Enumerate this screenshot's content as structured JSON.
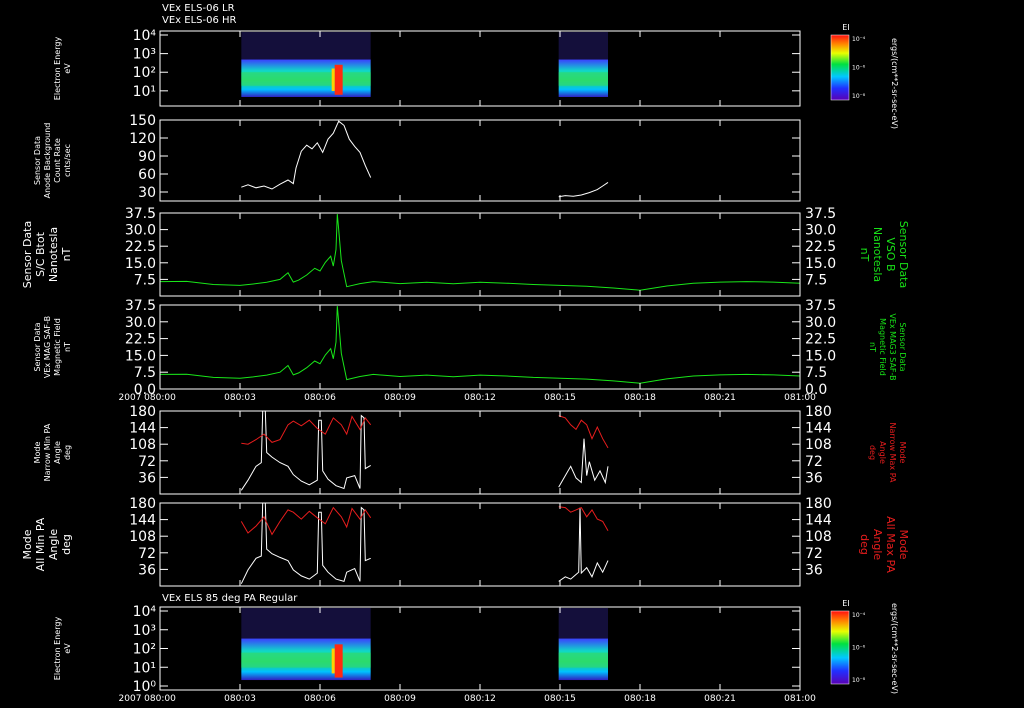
{
  "header": {
    "line1": "VEx ELS-06 LR",
    "line2": "VEx ELS-06 HR",
    "bottom_title": "VEx ELS 85 deg PA Regular"
  },
  "colors": {
    "background": "#000000",
    "white_trace": "#ffffff",
    "green_trace": "#19e619",
    "red_trace": "#e81d1d",
    "green_label": "#18e218",
    "red_label": "#e81d1d"
  },
  "time_axis": {
    "year_label": "2007",
    "ticks": [
      "080:00",
      "080:03",
      "080:06",
      "080:09",
      "080:12",
      "080:15",
      "080:18",
      "080:21",
      "081:00"
    ],
    "range_minutes": [
      0,
      24
    ]
  },
  "colorbar": {
    "title": "EI",
    "unit_label": "ergs/(cm**2-sr-sec-eV)",
    "tick_labels": [
      "10⁻⁴",
      "10⁻⁶",
      "10⁻⁸"
    ]
  },
  "chart_data": [
    {
      "type": "heatmap",
      "id": "spectrogram-top",
      "ylabel": [
        "Electron Energy",
        "eV"
      ],
      "y_scale": "log",
      "yticks": [
        "10⁴",
        "10³",
        "10²",
        "10¹"
      ],
      "data_intervals_minutes": [
        [
          3.05,
          7.9
        ],
        [
          14.95,
          16.8
        ]
      ],
      "peak_minute": 6.7
    },
    {
      "type": "line",
      "id": "anode-background",
      "ylabel": [
        "Sensor Data",
        "Anode Background",
        "Count Rate",
        "cnts/sec"
      ],
      "ylim": [
        15,
        150
      ],
      "yticks": [
        "150",
        "120",
        "90",
        "60",
        "30"
      ],
      "series": [
        {
          "color": "white",
          "x": [
            3.05,
            3.3,
            3.6,
            3.9,
            4.2,
            4.5,
            4.8,
            5.0,
            5.1,
            5.3,
            5.5,
            5.7,
            5.9,
            6.1,
            6.3,
            6.5,
            6.7,
            6.9,
            7.1,
            7.3,
            7.5,
            7.7,
            7.9
          ],
          "y": [
            38,
            42,
            37,
            40,
            35,
            43,
            50,
            44,
            70,
            98,
            108,
            102,
            112,
            96,
            118,
            128,
            148,
            141,
            118,
            106,
            96,
            74,
            54
          ]
        },
        {
          "color": "white",
          "x": [
            14.95,
            15.2,
            15.5,
            15.8,
            16.1,
            16.4,
            16.6,
            16.8
          ],
          "y": [
            22,
            24,
            23,
            25,
            29,
            34,
            40,
            46
          ]
        }
      ]
    },
    {
      "type": "line",
      "id": "scbtot",
      "ylabel": [
        "Sensor Data",
        "S/C Btot",
        "Nanotesla",
        "nT"
      ],
      "ylabel_right": [
        "Sensor Data",
        "VSO B",
        "Nanotesla",
        "nT"
      ],
      "ylim": [
        0,
        37.5
      ],
      "yticks": [
        "37.5",
        "30.0",
        "22.5",
        "15.0",
        "7.5"
      ],
      "series": [
        {
          "color": "green",
          "x": [
            0,
            1,
            2,
            3,
            3.5,
            4,
            4.5,
            4.8,
            5.0,
            5.2,
            5.5,
            5.8,
            6.0,
            6.2,
            6.4,
            6.5,
            6.6,
            6.65,
            6.7,
            6.8,
            7.0,
            7.5,
            8,
            9,
            10,
            11,
            12,
            13,
            14,
            15,
            16,
            17,
            18,
            19,
            20,
            21,
            22,
            23,
            24
          ],
          "y": [
            6.5,
            6.6,
            5.2,
            4.8,
            5.4,
            6.2,
            7.5,
            10.5,
            6.3,
            7.2,
            9.5,
            12.5,
            11.3,
            15.2,
            18.0,
            13.5,
            21.0,
            37.0,
            30.0,
            16.0,
            4.2,
            5.6,
            6.5,
            5.6,
            6.2,
            5.5,
            6.2,
            5.8,
            5.2,
            4.8,
            4.4,
            3.6,
            2.6,
            4.5,
            5.8,
            6.3,
            6.5,
            6.3,
            5.8
          ]
        }
      ]
    },
    {
      "type": "line",
      "id": "mag-field",
      "ylabel": [
        "Sensor Data",
        "VEx MAG SAF-B",
        "Magnetic Field",
        "nT"
      ],
      "ylabel_right": [
        "Sensor Data",
        "VEx MAG3 SAF-B",
        "Magnetic Field",
        "nT"
      ],
      "ylim": [
        0,
        37.5
      ],
      "yticks": [
        "37.5",
        "30.0",
        "22.5",
        "15.0",
        "7.5",
        "0.0"
      ],
      "series": [
        {
          "color": "green",
          "x": [
            0,
            1,
            2,
            3,
            3.5,
            4,
            4.5,
            4.8,
            5.0,
            5.2,
            5.5,
            5.8,
            6.0,
            6.2,
            6.4,
            6.5,
            6.6,
            6.65,
            6.7,
            6.8,
            7.0,
            7.5,
            8,
            9,
            10,
            11,
            12,
            13,
            14,
            15,
            16,
            17,
            18,
            19,
            20,
            21,
            22,
            23,
            24
          ],
          "y": [
            6.5,
            6.6,
            5.2,
            4.8,
            5.4,
            6.2,
            7.5,
            10.5,
            6.3,
            7.2,
            9.5,
            12.5,
            11.3,
            15.2,
            18.0,
            13.5,
            21.0,
            37.0,
            30.0,
            16.0,
            4.2,
            5.6,
            6.5,
            5.6,
            6.2,
            5.5,
            6.2,
            5.8,
            5.2,
            4.8,
            4.4,
            3.6,
            2.6,
            4.5,
            5.8,
            6.3,
            6.5,
            6.3,
            5.8
          ]
        }
      ]
    },
    {
      "type": "line",
      "id": "narrow-pa",
      "ylabel": [
        "Mode",
        "Narrow Min PA",
        "Angle",
        "deg"
      ],
      "ylabel_right": [
        "Mode",
        "Narrow Max PA",
        "Angle",
        "deg"
      ],
      "ylim": [
        0,
        180
      ],
      "yticks": [
        "180",
        "144",
        "108",
        "72",
        "36"
      ],
      "series": [
        {
          "color": "white",
          "x": [
            3.05,
            3.3,
            3.6,
            3.8,
            3.85,
            3.95,
            4.0,
            4.2,
            4.5,
            4.8,
            5.0,
            5.3,
            5.6,
            5.9,
            5.95,
            6.05,
            6.1,
            6.3,
            6.6,
            6.9,
            7.0,
            7.3,
            7.5,
            7.55,
            7.65,
            7.7,
            7.9
          ],
          "y": [
            8,
            30,
            60,
            68,
            180,
            180,
            90,
            80,
            68,
            60,
            42,
            28,
            20,
            30,
            160,
            160,
            50,
            32,
            18,
            12,
            35,
            40,
            12,
            170,
            165,
            55,
            62
          ],
          "breaks": [
            [
              14.95,
              16.8
            ]
          ]
        },
        {
          "color": "white",
          "x": [
            14.95,
            15.2,
            15.4,
            15.6,
            15.8,
            15.9,
            16.0,
            16.1,
            16.3,
            16.5,
            16.7,
            16.8
          ],
          "y": [
            15,
            40,
            60,
            35,
            25,
            120,
            40,
            70,
            30,
            50,
            25,
            60
          ]
        },
        {
          "color": "red",
          "x": [
            3.05,
            3.3,
            3.6,
            3.9,
            4.2,
            4.5,
            4.8,
            5.0,
            5.3,
            5.6,
            5.9,
            6.2,
            6.5,
            6.8,
            7.0,
            7.2,
            7.5,
            7.7,
            7.9
          ],
          "y": [
            110,
            108,
            118,
            130,
            112,
            118,
            150,
            158,
            148,
            160,
            142,
            130,
            165,
            150,
            130,
            168,
            140,
            165,
            150
          ]
        },
        {
          "color": "red",
          "x": [
            14.95,
            15.2,
            15.4,
            15.6,
            15.8,
            16.0,
            16.2,
            16.4,
            16.6,
            16.8
          ],
          "y": [
            170,
            165,
            150,
            140,
            160,
            150,
            120,
            145,
            120,
            100
          ]
        }
      ]
    },
    {
      "type": "line",
      "id": "all-pa",
      "ylabel": [
        "Mode",
        "All Min PA",
        "Angle",
        "deg"
      ],
      "ylabel_right": [
        "Mode",
        "All Max PA",
        "Angle",
        "deg"
      ],
      "ylim": [
        0,
        180
      ],
      "yticks": [
        "180",
        "144",
        "108",
        "72",
        "36"
      ],
      "series": [
        {
          "color": "white",
          "x": [
            3.05,
            3.3,
            3.6,
            3.8,
            3.85,
            3.95,
            4.0,
            4.2,
            4.5,
            4.8,
            5.0,
            5.3,
            5.6,
            5.9,
            5.95,
            6.05,
            6.1,
            6.3,
            6.6,
            6.9,
            7.0,
            7.3,
            7.5,
            7.55,
            7.65,
            7.7,
            7.9
          ],
          "y": [
            5,
            35,
            60,
            65,
            180,
            180,
            80,
            70,
            62,
            55,
            35,
            22,
            15,
            28,
            160,
            160,
            45,
            30,
            15,
            10,
            30,
            38,
            10,
            170,
            165,
            55,
            60
          ]
        },
        {
          "color": "white",
          "x": [
            14.95,
            15.2,
            15.4,
            15.6,
            15.7,
            15.75,
            15.8,
            16.0,
            16.2,
            16.4,
            16.6,
            16.8
          ],
          "y": [
            10,
            20,
            15,
            25,
            30,
            170,
            28,
            40,
            20,
            50,
            30,
            55
          ]
        },
        {
          "color": "red",
          "x": [
            3.05,
            3.3,
            3.6,
            3.9,
            4.2,
            4.5,
            4.8,
            5.0,
            5.3,
            5.6,
            5.9,
            6.2,
            6.5,
            6.8,
            7.0,
            7.2,
            7.5,
            7.7,
            7.9
          ],
          "y": [
            140,
            115,
            130,
            150,
            112,
            140,
            165,
            160,
            145,
            162,
            148,
            135,
            170,
            150,
            128,
            168,
            145,
            165,
            148
          ]
        },
        {
          "color": "red",
          "x": [
            14.95,
            15.2,
            15.4,
            15.6,
            15.8,
            16.0,
            16.2,
            16.4,
            16.6,
            16.8
          ],
          "y": [
            172,
            170,
            160,
            165,
            170,
            150,
            165,
            145,
            140,
            120
          ]
        }
      ]
    },
    {
      "type": "heatmap",
      "id": "spectrogram-bottom",
      "ylabel": [
        "Electron Energy",
        "eV"
      ],
      "y_scale": "log",
      "yticks": [
        "10⁴",
        "10³",
        "10²",
        "10¹",
        "10⁰"
      ],
      "data_intervals_minutes": [
        [
          3.05,
          7.9
        ],
        [
          14.95,
          16.8
        ]
      ],
      "peak_minute": 6.7
    }
  ]
}
